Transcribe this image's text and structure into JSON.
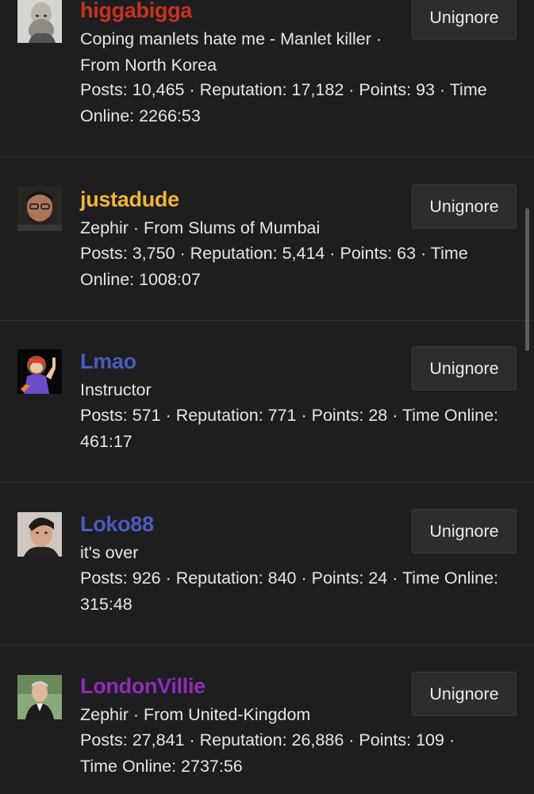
{
  "colors": {
    "background": "#1e1e20",
    "divider": "#2e2e31",
    "button_bg": "#2d2d30",
    "text": "#e6e6e8"
  },
  "button_label": "Unignore",
  "users": [
    {
      "username": "higgabigga",
      "username_color": "#c8321e",
      "line1": "Coping manlets hate me - Manlet killer · From North Korea",
      "line2": "Posts: 10,465 · Reputation: 17,182 · Points: 93 · Time Online: 2266:53",
      "avatar_icon": "avatar-bearded-man"
    },
    {
      "username": "justadude",
      "username_color": "#f2b336",
      "line1": "Zephir · From Slums of Mumbai",
      "line2": "Posts: 3,750 · Reputation: 5,414 · Points: 63 · Time Online: 1008:07",
      "avatar_icon": "avatar-man-glasses"
    },
    {
      "username": "Lmao",
      "username_color": "#4a5bbd",
      "line1": "Instructor",
      "line2": "Posts: 571 · Reputation: 771 · Points: 28 · Time Online: 461:17",
      "avatar_icon": "avatar-cartoon-monkey"
    },
    {
      "username": "Loko88",
      "username_color": "#4a5bbd",
      "line1": "it's over",
      "line2": "Posts: 926 · Reputation: 840 · Points: 24 · Time Online: 315:48",
      "avatar_icon": "avatar-male-model"
    },
    {
      "username": "LondonVillie",
      "username_color": "#8e2bb8",
      "line1": "Zephir · From United-Kingdom",
      "line2": "Posts: 27,841 · Reputation: 26,886 · Points: 109 · Time Online: 2737:56",
      "avatar_icon": "avatar-older-man"
    }
  ]
}
